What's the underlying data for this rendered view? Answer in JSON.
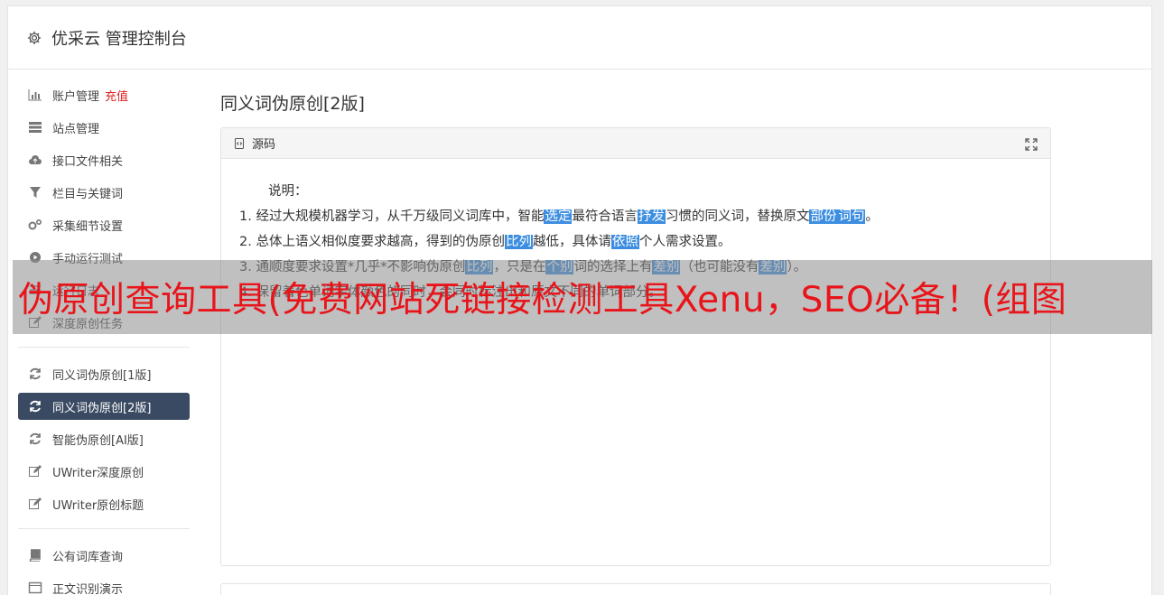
{
  "header": {
    "title": "优采云 管理控制台"
  },
  "sidebar": {
    "group1": [
      {
        "label": "账户管理",
        "badge": "充值",
        "icon": "bar-chart-icon"
      },
      {
        "label": "站点管理",
        "icon": "server-icon"
      },
      {
        "label": "接口文件相关",
        "icon": "cloud-upload-icon"
      },
      {
        "label": "栏目与关键词",
        "icon": "filter-icon"
      },
      {
        "label": "采集细节设置",
        "icon": "gears-icon"
      },
      {
        "label": "手动运行测试",
        "icon": "play-circle-icon"
      },
      {
        "label": "运行日志",
        "icon": "list-icon"
      },
      {
        "label": "深度原创任务",
        "icon": "edit-icon"
      }
    ],
    "group2": [
      {
        "label": "同义词伪原创[1版]",
        "icon": "refresh-icon"
      },
      {
        "label": "同义词伪原创[2版]",
        "icon": "refresh-icon",
        "active": true
      },
      {
        "label": "智能伪原创[AI版]",
        "icon": "refresh-icon"
      },
      {
        "label": "UWriter深度原创",
        "icon": "edit-icon"
      },
      {
        "label": "UWriter原创标题",
        "icon": "edit-icon"
      }
    ],
    "group3": [
      {
        "label": "公有词库查询",
        "icon": "book-icon"
      },
      {
        "label": "正文识别演示",
        "icon": "window-icon"
      }
    ]
  },
  "main": {
    "title": "同义词伪原创[2版]",
    "panel": {
      "header": "源码",
      "intro": "说明：",
      "lines": [
        [
          {
            "t": "1. 经过大规模机器学习，从千万级同义词库中，智能"
          },
          {
            "t": "选定",
            "h": true
          },
          {
            "t": "最符合语言"
          },
          {
            "t": "抒发",
            "h": true
          },
          {
            "t": "习惯的同义词，替换原文"
          },
          {
            "t": "部份",
            "h": true
          },
          {
            "t": "词句",
            "h": true
          },
          {
            "t": "。"
          }
        ],
        [
          {
            "t": "2. 总体上语义相似度要求越高，得到的伪原创"
          },
          {
            "t": "比列",
            "h": true
          },
          {
            "t": "越低，具体请"
          },
          {
            "t": "依照",
            "h": true
          },
          {
            "t": "个人需求设置。"
          }
        ],
        [
          {
            "t": "3. 通顺度要求设置*几乎*不影响伪原创"
          },
          {
            "t": "比列",
            "h": true
          },
          {
            "t": "，只是在"
          },
          {
            "t": "个别",
            "h": true
          },
          {
            "t": "词的选择上有"
          },
          {
            "t": "差别",
            "h": true
          },
          {
            "t": "（也可能没有"
          },
          {
            "t": "差别",
            "h": true
          },
          {
            "t": "）。"
          }
        ],
        [
          {
            "t": "4. 保留着色单词字体颜色的同时，会同时标注出和原文不同的单词部分。"
          }
        ]
      ]
    }
  },
  "overlay": {
    "text": "伪原创查询工具(免费网站死链接检测工具Xenu，SEO必备！(组图"
  },
  "colors": {
    "active_nav": "#3a4a62",
    "highlight": "#3d8ee0",
    "overlay_text": "#e8141a",
    "badge": "#e02020"
  }
}
